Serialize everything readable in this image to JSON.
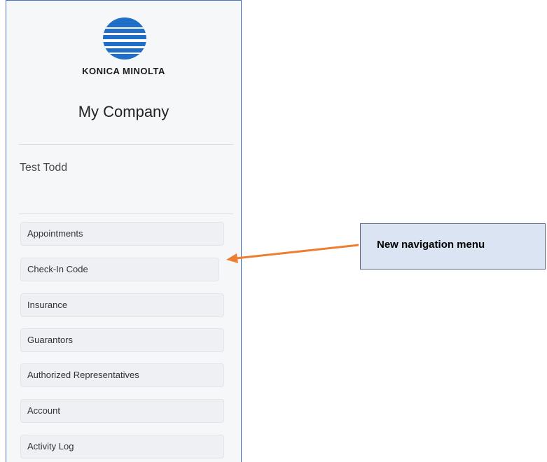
{
  "sidebar": {
    "logo": {
      "brand_text": "KONICA MINOLTA",
      "icon": "konica-minolta-globe-logo",
      "color": "#1f6fc8"
    },
    "company_name": "My Company",
    "user_name": "Test Todd",
    "nav_items": [
      {
        "label": "Appointments"
      },
      {
        "label": "Check-In Code"
      },
      {
        "label": "Insurance"
      },
      {
        "label": "Guarantors"
      },
      {
        "label": "Authorized Representatives"
      },
      {
        "label": "Account"
      },
      {
        "label": "Activity Log"
      }
    ]
  },
  "annotation": {
    "callout_text": "New navigation menu",
    "arrow_color": "#ed7d31",
    "callout_fill": "#dae4f3"
  }
}
